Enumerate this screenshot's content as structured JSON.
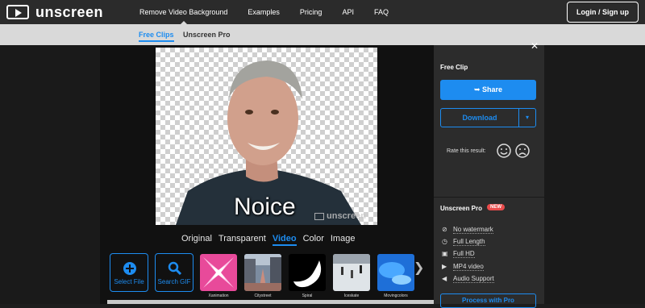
{
  "header": {
    "logo_text": "unscreen",
    "nav": [
      "Remove Video Background",
      "Examples",
      "Pricing",
      "API",
      "FAQ"
    ],
    "login": "Login / Sign up"
  },
  "subnav": {
    "free": "Free Clips",
    "pro": "Unscreen Pro"
  },
  "preview": {
    "caption": "Noice",
    "watermark": "unscreen"
  },
  "tabs": [
    "Original",
    "Transparent",
    "Video",
    "Color",
    "Image"
  ],
  "active_tab": "Video",
  "tiles": {
    "select_file": "Select File",
    "search_gif": "Search GIF"
  },
  "backgrounds": [
    "Xanimation",
    "Citystreet",
    "Spiral",
    "Iceskate",
    "Movingcolors"
  ],
  "panel": {
    "title": "Free Clip",
    "share": "Share",
    "download": "Download",
    "rate": "Rate this result:",
    "pro_title": "Unscreen Pro",
    "badge": "NEW",
    "features": [
      "No watermark",
      "Full Length",
      "Full HD",
      "MP4 video",
      "Audio Support"
    ],
    "process": "Process with Pro"
  },
  "colors": {
    "accent": "#1d8cf0",
    "badge": "#ea4c4c",
    "panel_bg": "#2c2c2c"
  }
}
